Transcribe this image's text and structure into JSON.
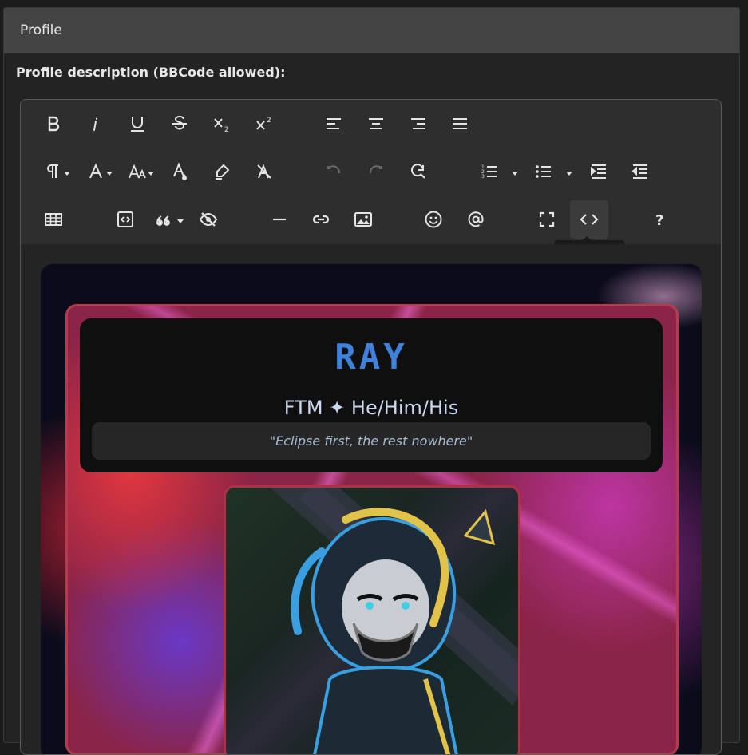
{
  "panel": {
    "title": "Profile"
  },
  "field": {
    "label": "Profile description (BBCode allowed):"
  },
  "toolbar": {
    "tooltip": "Code View"
  },
  "profile_card": {
    "name": "RAY",
    "subtitle": "FTM ✦ He/Him/His",
    "quote": "\"Eclipse first, the rest nowhere\""
  },
  "colors": {
    "accent_blue": "#3d83de",
    "frame_red": "#b83a4d",
    "toolbar_bg": "#2e2e2e"
  }
}
